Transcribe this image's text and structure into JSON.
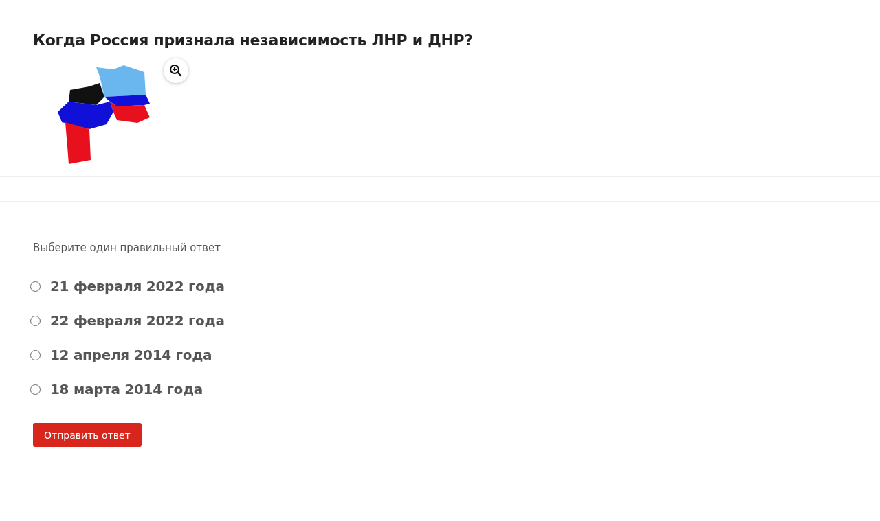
{
  "question": {
    "title": "Когда Россия признала независимость ЛНР и ДНР?"
  },
  "instruction": "Выберите один правильный ответ",
  "options": [
    {
      "label": "21 февраля 2022 года",
      "selected": false
    },
    {
      "label": "22 февраля 2022 года",
      "selected": false
    },
    {
      "label": "12 апреля 2014 года",
      "selected": false
    },
    {
      "label": "18 марта 2014 года",
      "selected": false
    }
  ],
  "submit_button": "Отправить ответ"
}
